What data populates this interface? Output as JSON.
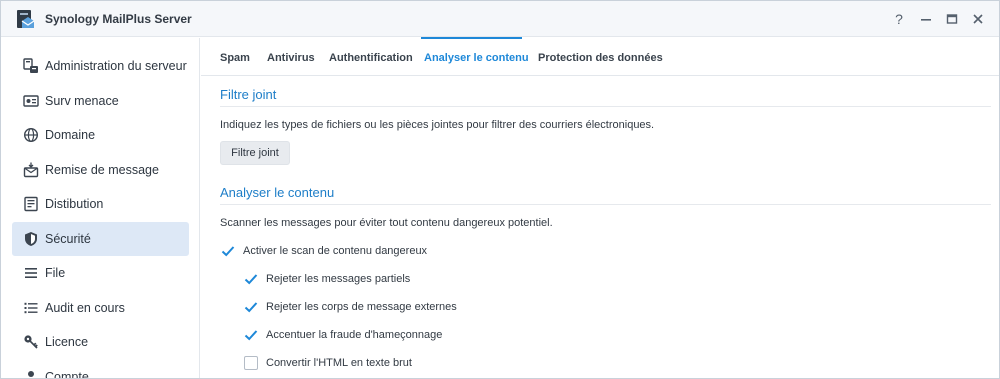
{
  "window": {
    "title": "Synology MailPlus Server",
    "controls": {
      "help": "?",
      "minimize": "—",
      "maximize": "▭",
      "close": "✕"
    }
  },
  "sidebar": {
    "items": [
      {
        "label": "Administration du serveur",
        "icon": "server-admin-icon",
        "active": false
      },
      {
        "label": "Surv menace",
        "icon": "threat-monitor-icon",
        "active": false
      },
      {
        "label": "Domaine",
        "icon": "globe-icon",
        "active": false
      },
      {
        "label": "Remise de message",
        "icon": "message-delivery-icon",
        "active": false
      },
      {
        "label": "Distibution",
        "icon": "distribution-icon",
        "active": false
      },
      {
        "label": "Sécurité",
        "icon": "shield-icon",
        "active": true
      },
      {
        "label": "File",
        "icon": "queue-icon",
        "active": false
      },
      {
        "label": "Audit en cours",
        "icon": "audit-list-icon",
        "active": false
      },
      {
        "label": "Licence",
        "icon": "key-icon",
        "active": false
      },
      {
        "label": "Compte",
        "icon": "user-icon",
        "active": false
      }
    ]
  },
  "tabs": [
    {
      "label": "Spam",
      "active": false
    },
    {
      "label": "Antivirus",
      "active": false
    },
    {
      "label": "Authentification",
      "active": false
    },
    {
      "label": "Analyser le contenu",
      "active": true
    },
    {
      "label": "Protection des données",
      "active": false
    }
  ],
  "attachment_filter": {
    "title": "Filtre joint",
    "description": "Indiquez les types de fichiers ou les pièces jointes pour filtrer des courriers électroniques.",
    "button": "Filtre joint"
  },
  "content_scan": {
    "title": "Analyser le contenu",
    "description": "Scanner les messages pour éviter tout contenu dangereux potentiel.",
    "main_option": {
      "label": "Activer le scan de contenu dangereux",
      "checked": true
    },
    "sub_options": [
      {
        "label": "Rejeter les messages partiels",
        "checked": true
      },
      {
        "label": "Rejeter les corps de message externes",
        "checked": true
      },
      {
        "label": "Accentuer la fraude d'hameçonnage",
        "checked": true
      },
      {
        "label": "Convertir l'HTML en texte brut",
        "checked": false
      }
    ]
  },
  "colors": {
    "accent": "#1e88d8",
    "active_bg": "#dde8f6",
    "checkbox": "#1e88d8"
  }
}
